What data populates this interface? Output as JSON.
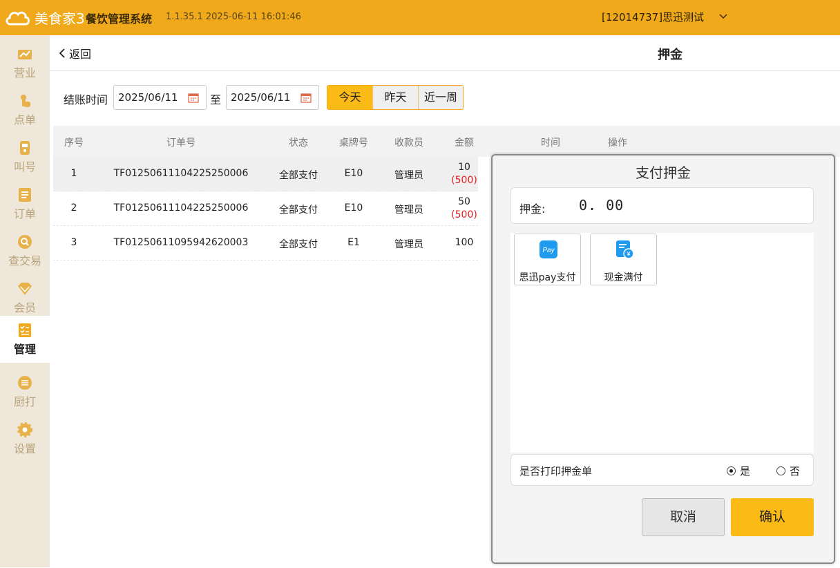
{
  "app": {
    "logo_text": "美食家3",
    "system_title": "餐饮管理系统",
    "version_info": "1.1.35.1 2025-06-11 16:01:46",
    "account": "[12014737]思迅测试"
  },
  "sidebar": {
    "items": [
      {
        "label": "营业",
        "icon": "chart-icon"
      },
      {
        "label": "点单",
        "icon": "hand-tap-icon"
      },
      {
        "label": "叫号",
        "icon": "pager-icon"
      },
      {
        "label": "订单",
        "icon": "list-icon"
      },
      {
        "label": "查交易",
        "icon": "search-circle-icon"
      },
      {
        "label": "会员",
        "icon": "diamond-icon"
      },
      {
        "label": "管理",
        "icon": "checklist-icon",
        "active": true
      },
      {
        "label": "厨打",
        "icon": "menu-circle-icon"
      },
      {
        "label": "设置",
        "icon": "gear-icon"
      }
    ]
  },
  "subheader": {
    "back_label": "返回",
    "page_title": "押金"
  },
  "filter": {
    "label": "结账时间",
    "date_from": "2025/06/11",
    "to_label": "至",
    "date_to": "2025/06/11",
    "quick_ranges": [
      "今天",
      "昨天",
      "近一周"
    ],
    "selected_range": "今天"
  },
  "table": {
    "headers": [
      "序号",
      "订单号",
      "状态",
      "桌牌号",
      "收款员",
      "金额",
      "时间",
      "操作"
    ],
    "rows": [
      {
        "no": "1",
        "order": "TF01250611104225250006",
        "status": "全部支付",
        "table": "E10",
        "cashier": "管理员",
        "amount": "10",
        "deposit": "(500)"
      },
      {
        "no": "2",
        "order": "TF01250611104225250006",
        "status": "全部支付",
        "table": "E10",
        "cashier": "管理员",
        "amount": "50",
        "deposit": "(500)"
      },
      {
        "no": "3",
        "order": "TF01250611095942620003",
        "status": "全部支付",
        "table": "E1",
        "cashier": "管理员",
        "amount": "100",
        "deposit": ""
      }
    ]
  },
  "dialog": {
    "title": "支付押金",
    "deposit_label": "押金:",
    "deposit_value": "0. 00",
    "pay_methods": [
      {
        "label": "思迅pay支付",
        "icon": "pay-icon",
        "color": "#1E9BF0"
      },
      {
        "label": "现金满付",
        "icon": "cash-receipt-icon",
        "color": "#1E9BF0"
      }
    ],
    "print_label": "是否打印押金单",
    "print_yes": "是",
    "print_no": "否",
    "print_selected": "是",
    "cancel_label": "取消",
    "confirm_label": "确认"
  },
  "colors": {
    "brand": "#F0A91B",
    "accent": "#FBBA15",
    "deposit_red": "#E02020"
  }
}
